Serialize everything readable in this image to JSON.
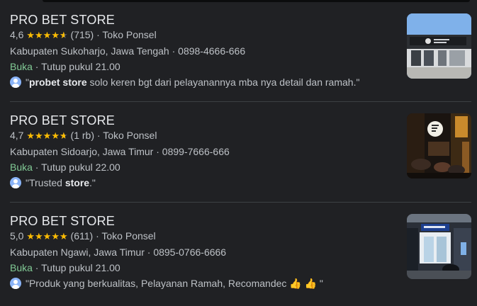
{
  "listings": [
    {
      "name": "PRO BET STORE",
      "rating": "4,6",
      "stars_value": 4.6,
      "reviews": "(715)",
      "category": "Toko Ponsel",
      "location": "Kabupaten Sukoharjo, Jawa Tengah",
      "phone": "0898-4666-666",
      "status": "Buka",
      "hours": "Tutup pukul 21.00",
      "review_open": "\"",
      "review_bold": "probet store",
      "review_rest": " solo keren bgt dari pelayanannya mba nya detail dan ramah.\"",
      "image": "store-front-photo"
    },
    {
      "name": "PRO BET STORE",
      "rating": "4,7",
      "stars_value": 4.7,
      "reviews": "(1 rb)",
      "category": "Toko Ponsel",
      "location": "Kabupaten Sidoarjo, Jawa Timur",
      "phone": "0899-7666-666",
      "status": "Buka",
      "hours": "Tutup pukul 22.00",
      "review_open": "\"Trusted ",
      "review_bold": "store",
      "review_rest": ".\"",
      "image": "night-store-photo"
    },
    {
      "name": "PRO BET STORE",
      "rating": "5,0",
      "stars_value": 5.0,
      "reviews": "(611)",
      "category": "Toko Ponsel",
      "location": "Kabupaten Ngawi, Jawa Timur",
      "phone": "0895-0766-6666",
      "status": "Buka",
      "hours": "Tutup pukul 21.00",
      "review_open": "\"Produk yang berkualitas, Pelayanan Ramah, Recomandec 👍 👍 \"",
      "review_bold": "",
      "review_rest": "",
      "image": "shop-entrance-photo"
    }
  ],
  "separator": " · ",
  "colors": {
    "background": "#202124",
    "title": "#e8eaed",
    "open": "#81c995",
    "stars": "#fbbc04"
  }
}
